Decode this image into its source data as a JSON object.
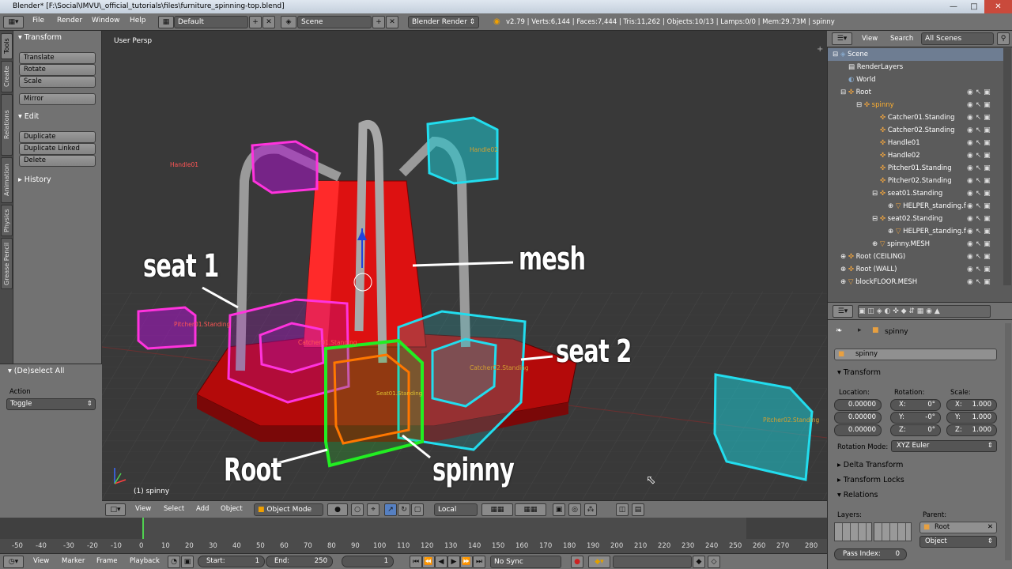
{
  "window": {
    "title": "Blender* [F:\\Social\\IMVU\\_official_tutorials\\files\\furniture_spinning-top.blend]"
  },
  "menubar": {
    "menus": [
      "File",
      "Render",
      "Window",
      "Help"
    ],
    "layout": "Default",
    "scene": "Scene",
    "engine": "Blender Render",
    "stats": "v2.79 | Verts:6,144 | Faces:7,444 | Tris:11,262 | Objects:10/13 | Lamps:0/0 | Mem:29.73M | spinny"
  },
  "left_tabs": [
    "Tools",
    "Create",
    "Relations",
    "Animation",
    "Physics",
    "Grease Pencil"
  ],
  "toolshelf": {
    "transform_header": "Transform",
    "transform_buttons": [
      "Translate",
      "Rotate",
      "Scale"
    ],
    "mirror": "Mirror",
    "edit_header": "Edit",
    "edit_buttons": [
      "Duplicate",
      "Duplicate Linked",
      "Delete"
    ],
    "history_header": "History",
    "operator_header": "(De)select All",
    "action_label": "Action",
    "action_value": "Toggle"
  },
  "viewport": {
    "view_name": "User Persp",
    "object_label": "(1) spinny",
    "annotations": {
      "seat1": "seat 1",
      "mesh": "mesh",
      "seat2": "seat 2",
      "root": "Root",
      "spinny": "spinny"
    },
    "empty_labels": {
      "handle01": "Handle01",
      "handle02": "Handle02",
      "pitcher01": "Pitcher01.Standing",
      "pitcher02": "Pitcher02.Standing",
      "catcher01": "Catcher01.Standing",
      "catcher02": "Catcher02.Standing",
      "seat": "Seat01.Standing"
    },
    "colors": {
      "magenta": "#ff33dd",
      "cyan": "#22ddee",
      "green": "#22ee22",
      "orange": "#ff7700",
      "red_mesh": "#dd1111"
    }
  },
  "viewport_header": {
    "menus": [
      "View",
      "Select",
      "Add",
      "Object"
    ],
    "mode": "Object Mode",
    "orientation": "Local"
  },
  "timeline": {
    "ticks": [
      "-50",
      "-40",
      "-30",
      "-20",
      "-10",
      "0",
      "10",
      "20",
      "30",
      "40",
      "50",
      "60",
      "70",
      "80",
      "90",
      "100",
      "110",
      "120",
      "130",
      "140",
      "150",
      "160",
      "170",
      "180",
      "190",
      "200",
      "210",
      "220",
      "230",
      "240",
      "250",
      "260",
      "270",
      "280"
    ],
    "current_frame_marker": "0"
  },
  "timeline_header": {
    "menus": [
      "View",
      "Marker",
      "Frame",
      "Playback"
    ],
    "start_label": "Start:",
    "start_value": "1",
    "end_label": "End:",
    "end_value": "250",
    "current": "1",
    "sync": "No Sync"
  },
  "outliner": {
    "header": {
      "view": "View",
      "search": "Search",
      "filter": "All Scenes"
    },
    "rows": [
      {
        "label": "Scene",
        "indent": 0
      },
      {
        "label": "RenderLayers",
        "indent": 1
      },
      {
        "label": "World",
        "indent": 1
      },
      {
        "label": "Root",
        "indent": 1
      },
      {
        "label": "spinny",
        "indent": 2
      },
      {
        "label": "Catcher01.Standing",
        "indent": 3
      },
      {
        "label": "Catcher02.Standing",
        "indent": 3
      },
      {
        "label": "Handle01",
        "indent": 3
      },
      {
        "label": "Handle02",
        "indent": 3
      },
      {
        "label": "Pitcher01.Standing",
        "indent": 3
      },
      {
        "label": "Pitcher02.Standing",
        "indent": 3
      },
      {
        "label": "seat01.Standing",
        "indent": 3
      },
      {
        "label": "HELPER_standing.f",
        "indent": 4
      },
      {
        "label": "seat02.Standing",
        "indent": 3
      },
      {
        "label": "HELPER_standing.f",
        "indent": 4
      },
      {
        "label": "spinny.MESH",
        "indent": 3
      },
      {
        "label": "Root (CEILING)",
        "indent": 1
      },
      {
        "label": "Root (WALL)",
        "indent": 1
      },
      {
        "label": "blockFLOOR.MESH",
        "indent": 1
      }
    ]
  },
  "properties": {
    "breadcrumb": "spinny",
    "object_name": "spinny",
    "transform_header": "Transform",
    "location_label": "Location:",
    "rotation_label": "Rotation:",
    "scale_label": "Scale:",
    "location": [
      "0.00000",
      "0.00000",
      "0.00000"
    ],
    "rotation": [
      {
        "axis": "X:",
        "value": "0°"
      },
      {
        "axis": "Y:",
        "value": "-0°"
      },
      {
        "axis": "Z:",
        "value": "0°"
      }
    ],
    "scale": [
      {
        "axis": "X:",
        "value": "1.000"
      },
      {
        "axis": "Y:",
        "value": "1.000"
      },
      {
        "axis": "Z:",
        "value": "1.000"
      }
    ],
    "rotation_mode_label": "Rotation Mode:",
    "rotation_mode": "XYZ Euler",
    "delta_transform": "Delta Transform",
    "transform_locks": "Transform Locks",
    "relations": "Relations",
    "layers_label": "Layers:",
    "parent_label": "Parent:",
    "parent_value": "Root",
    "parent_type": "Object",
    "pass_index_label": "Pass Index:",
    "pass_index_value": "0"
  }
}
